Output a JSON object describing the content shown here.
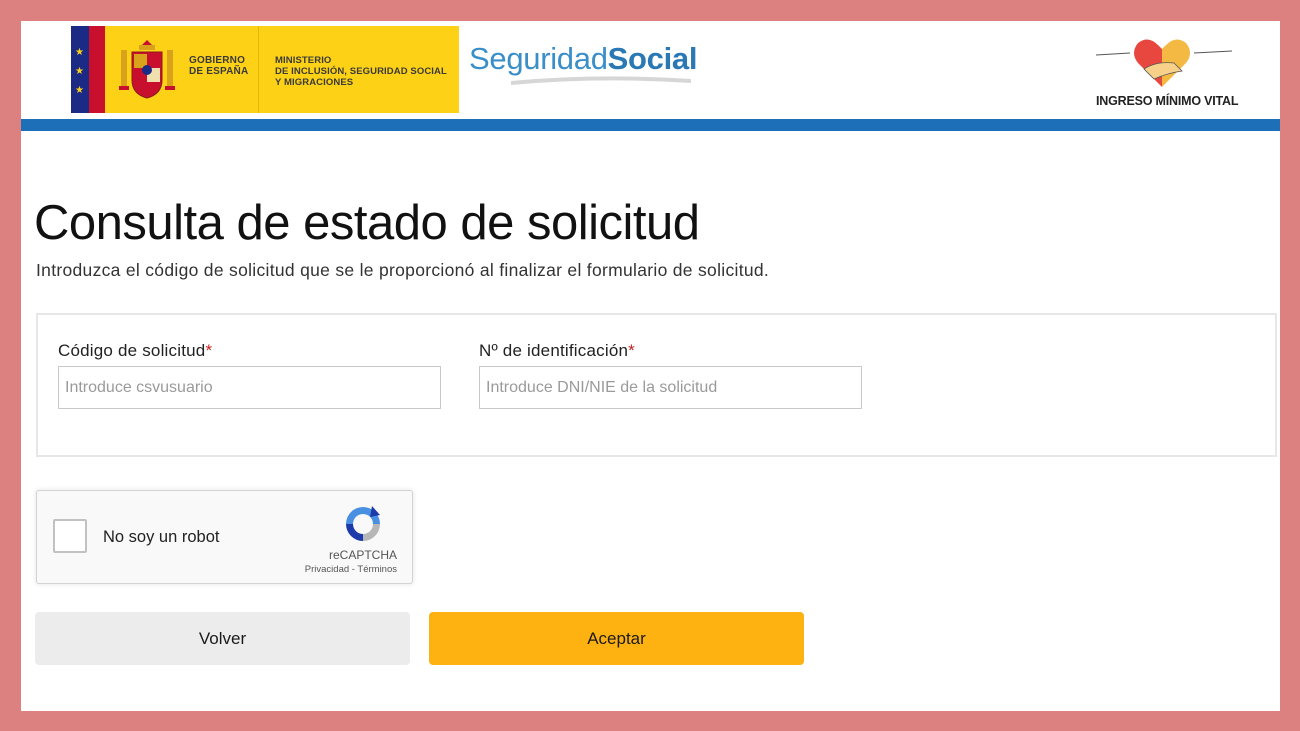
{
  "header": {
    "gobierno_line1": "GOBIERNO",
    "gobierno_line2": "DE ESPAÑA",
    "ministerio_line1": "MINISTERIO",
    "ministerio_line2": "DE INCLUSIÓN, SEGURIDAD SOCIAL",
    "ministerio_line3": "Y MIGRACIONES",
    "ss_part1": "Seguridad",
    "ss_part2": "Social",
    "imv_label": "INGRESO MÍNIMO VITAL",
    "icons": {
      "coat_of_arms": "coat-of-arms-icon",
      "imv_heart": "heart-hands-icon"
    }
  },
  "colors": {
    "frame_border": "#dd8180",
    "header_bar": "#1d70b7",
    "gov_yellow": "#fcd116",
    "accept_button": "#fdb212",
    "back_button": "#ececec",
    "required_mark": "#c81f1f"
  },
  "main": {
    "title": "Consulta de estado de solicitud",
    "subtitle": "Introduzca el código de solicitud que se le proporcionó al finalizar el formulario de solicitud."
  },
  "form": {
    "code_label": "Código de solicitud",
    "code_placeholder": "Introduce csvusuario",
    "code_value": "",
    "id_label": "Nº de identificación",
    "id_placeholder": "Introduce DNI/NIE de la solicitud",
    "id_value": "",
    "required_mark": "*"
  },
  "captcha": {
    "label": "No soy un robot",
    "brand": "reCAPTCHA",
    "links": "Privacidad - Términos",
    "icon": "recaptcha-icon"
  },
  "buttons": {
    "back": "Volver",
    "accept": "Aceptar"
  }
}
